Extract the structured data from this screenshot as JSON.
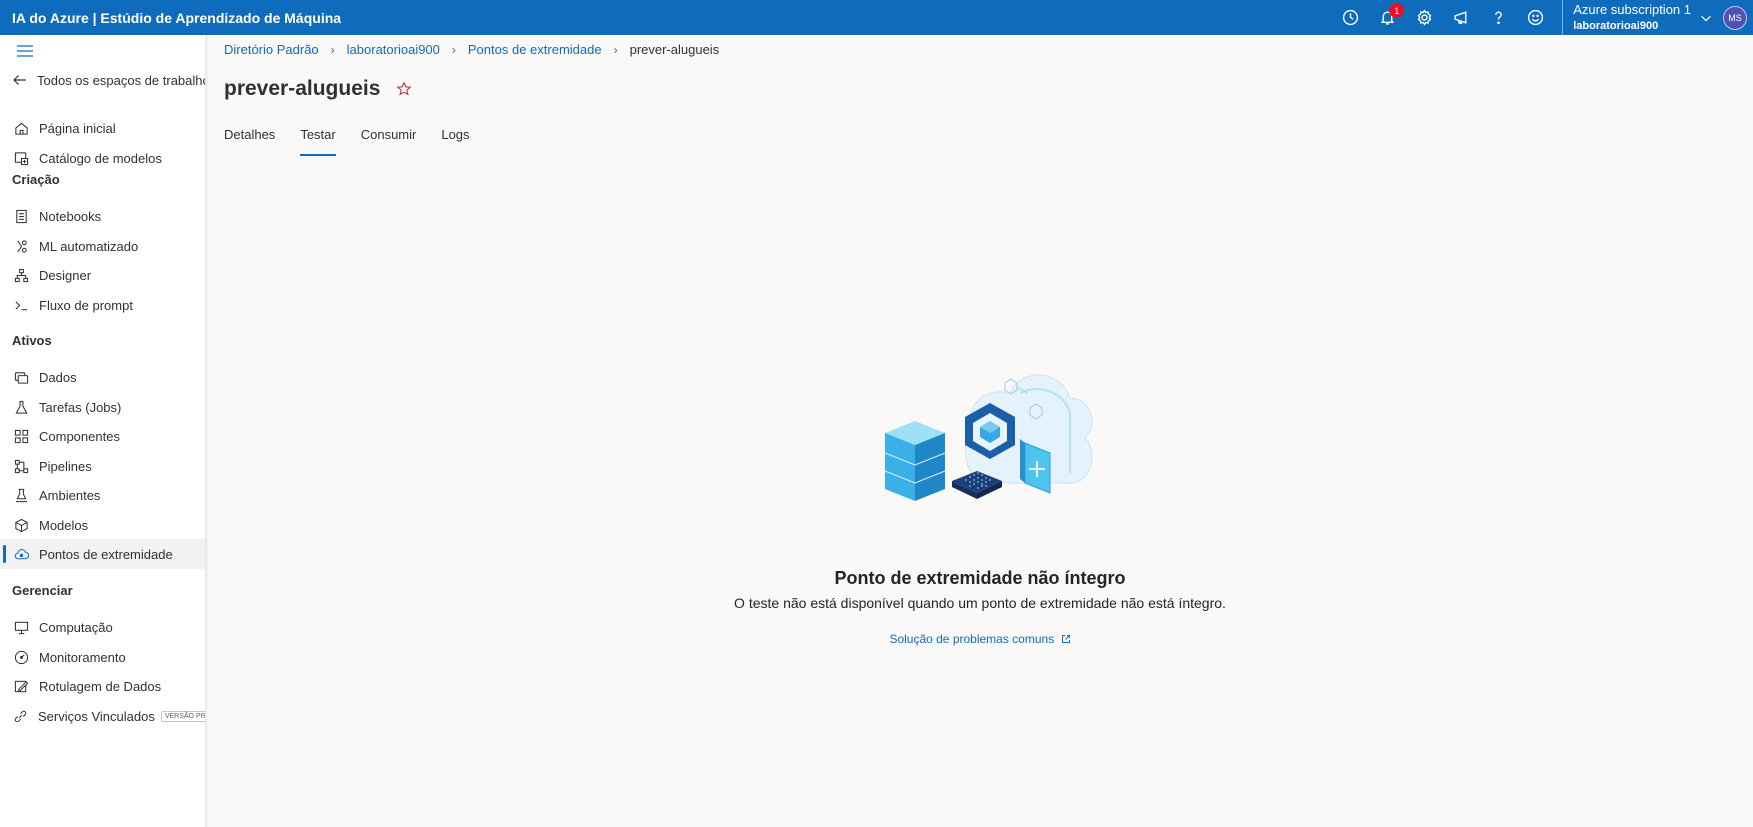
{
  "app": {
    "title": "IA do Azure | Estúdio de Aprendizado de Máquina",
    "notification_count": "1",
    "account": {
      "subscription": "Azure subscription 1",
      "workspace": "laboratorioai900",
      "initials": "MS"
    },
    "icons": [
      "clock-icon",
      "bell-icon",
      "gear-icon",
      "megaphone-icon",
      "help-icon",
      "smiley-icon",
      "chevron-down-icon"
    ]
  },
  "sidebar": {
    "back_label": "Todos os espaços de trabalho",
    "items_top": [
      {
        "label": "Página inicial",
        "icon": "home-icon"
      },
      {
        "label": "Catálogo de modelos",
        "icon": "catalog-icon"
      }
    ],
    "sections": {
      "criacao": "Criação",
      "ativos": "Ativos",
      "gerenciar": "Gerenciar"
    },
    "items_criacao": [
      {
        "label": "Notebooks",
        "icon": "notebook-icon"
      },
      {
        "label": "ML automatizado",
        "icon": "automl-icon"
      },
      {
        "label": "Designer",
        "icon": "designer-icon"
      },
      {
        "label": "Fluxo de prompt",
        "icon": "prompt-icon"
      }
    ],
    "items_ativos": [
      {
        "label": "Dados",
        "icon": "data-icon"
      },
      {
        "label": "Tarefas (Jobs)",
        "icon": "flask-icon"
      },
      {
        "label": "Componentes",
        "icon": "components-icon"
      },
      {
        "label": "Pipelines",
        "icon": "pipeline-icon"
      },
      {
        "label": "Ambientes",
        "icon": "environment-icon"
      },
      {
        "label": "Modelos",
        "icon": "model-icon"
      },
      {
        "label": "Pontos de extremidade",
        "icon": "endpoint-icon",
        "active": true
      }
    ],
    "items_gerenciar": [
      {
        "label": "Computação",
        "icon": "compute-icon"
      },
      {
        "label": "Monitoramento",
        "icon": "monitor-icon"
      },
      {
        "label": "Rotulagem de Dados",
        "icon": "labeling-icon"
      },
      {
        "label": "Serviços Vinculados",
        "icon": "link-icon",
        "badge": "VERSÃO PRÉVIA"
      }
    ]
  },
  "breadcrumb": [
    "Diretório Padrão",
    "laboratorioai900",
    "Pontos de extremidade",
    "prever-alugueis"
  ],
  "page": {
    "title": "prever-alugueis",
    "tabs": [
      "Detalhes",
      "Testar",
      "Consumir",
      "Logs"
    ],
    "active_tab": "Testar"
  },
  "empty_state": {
    "title": "Ponto de extremidade não íntegro",
    "description": "O teste não está disponível quando um ponto de extremidade não está íntegro.",
    "link": "Solução de problemas comuns"
  },
  "colors": {
    "accent": "#0f6cbd",
    "badge": "#e81123",
    "star": "#c4314b"
  }
}
